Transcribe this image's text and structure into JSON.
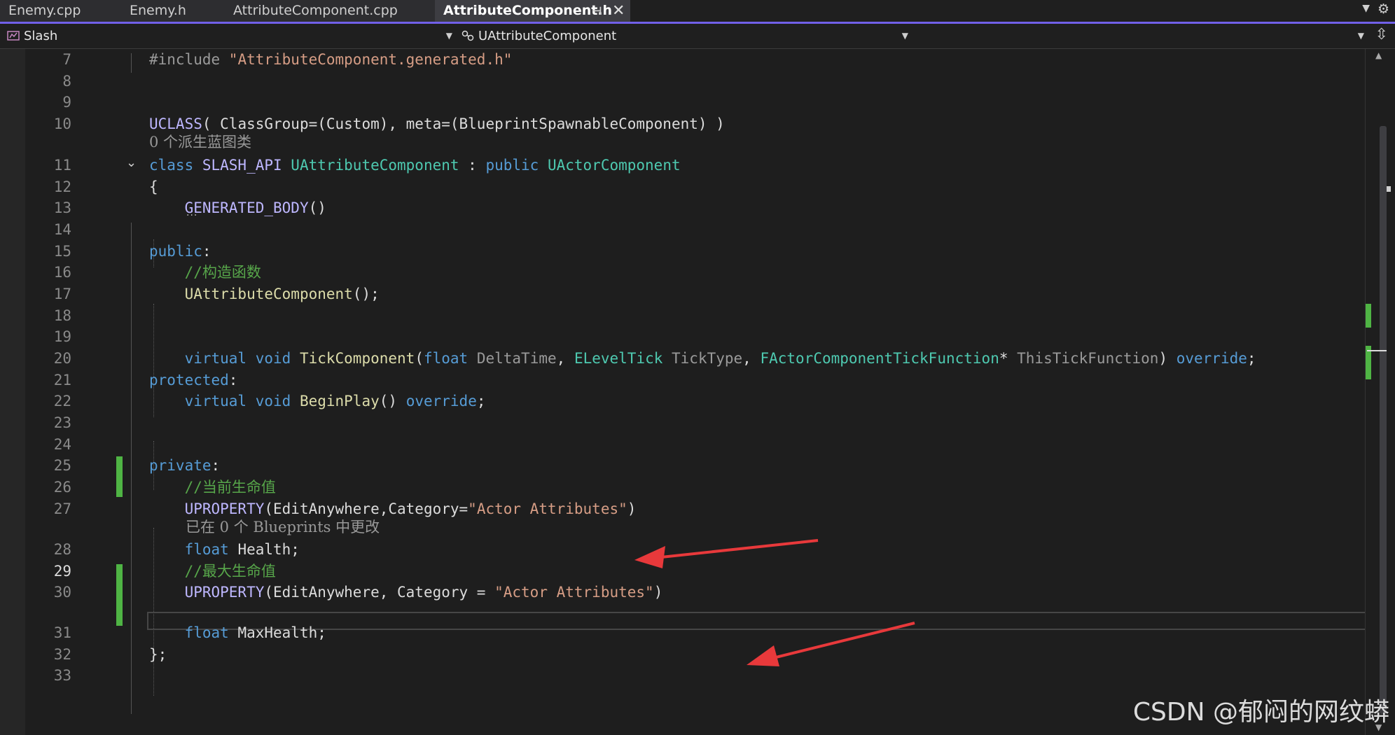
{
  "tabs": [
    {
      "label": "Enemy.cpp"
    },
    {
      "label": "Enemy.h"
    },
    {
      "label": "AttributeComponent.cpp"
    },
    {
      "label": "AttributeComponent.h"
    }
  ],
  "tab_pin_icon": "pin-icon",
  "tab_close_icon": "close-icon",
  "nav": {
    "project": "Slash",
    "scope": "UAttributeComponent",
    "member": ""
  },
  "editor": {
    "current_line": 29,
    "lines": [
      {
        "num": "7",
        "tokens": [
          [
            "p",
            "#include "
          ],
          [
            "s",
            "\"AttributeComponent.generated.h\""
          ]
        ]
      },
      {
        "num": "8",
        "tokens": []
      },
      {
        "num": "9",
        "tokens": []
      },
      {
        "num": "10",
        "tokens": [
          [
            "m",
            "UCLASS"
          ],
          [
            "w",
            "( "
          ],
          [
            "w",
            "ClassGroup=(Custom), meta=(BlueprintSpawnableComponent) )"
          ]
        ]
      },
      {
        "num": "11",
        "tokens": [
          [
            "k",
            "class "
          ],
          [
            "m",
            "SLASH_API "
          ],
          [
            "t",
            "UAttributeComponent"
          ],
          [
            "w",
            " : "
          ],
          [
            "k",
            "public "
          ],
          [
            "t",
            "UActorComponent"
          ]
        ]
      },
      {
        "num": "12",
        "tokens": [
          [
            "w",
            "{"
          ]
        ]
      },
      {
        "num": "13",
        "tokens": [
          [
            "w",
            "    "
          ],
          [
            "m",
            "GENERATED_BODY"
          ],
          [
            "w",
            "()"
          ]
        ]
      },
      {
        "num": "14",
        "tokens": []
      },
      {
        "num": "15",
        "tokens": [
          [
            "k",
            "public"
          ],
          [
            "w",
            ":"
          ]
        ]
      },
      {
        "num": "16",
        "tokens": [
          [
            "w",
            "    "
          ],
          [
            "c",
            "//构造函数"
          ]
        ]
      },
      {
        "num": "17",
        "tokens": [
          [
            "w",
            "    "
          ],
          [
            "f",
            "UAttributeComponent"
          ],
          [
            "w",
            "();"
          ]
        ]
      },
      {
        "num": "18",
        "tokens": []
      },
      {
        "num": "19",
        "tokens": []
      },
      {
        "num": "20",
        "tokens": [
          [
            "w",
            "    "
          ],
          [
            "k",
            "virtual "
          ],
          [
            "k",
            "void "
          ],
          [
            "f",
            "TickComponent"
          ],
          [
            "w",
            "("
          ],
          [
            "k",
            "float "
          ],
          [
            "p",
            "DeltaTime"
          ],
          [
            "w",
            ", "
          ],
          [
            "t",
            "ELevelTick "
          ],
          [
            "p",
            "TickType"
          ],
          [
            "w",
            ", "
          ],
          [
            "t",
            "FActorComponentTickFunction"
          ],
          [
            "w",
            "* "
          ],
          [
            "p",
            "ThisTickFunction"
          ],
          [
            "w",
            ") "
          ],
          [
            "k",
            "override"
          ],
          [
            "w",
            ";"
          ]
        ]
      },
      {
        "num": "21",
        "tokens": [
          [
            "k",
            "protected"
          ],
          [
            "w",
            ":"
          ]
        ]
      },
      {
        "num": "22",
        "tokens": [
          [
            "w",
            "    "
          ],
          [
            "k",
            "virtual "
          ],
          [
            "k",
            "void "
          ],
          [
            "f",
            "BeginPlay"
          ],
          [
            "w",
            "() "
          ],
          [
            "k",
            "override"
          ],
          [
            "w",
            ";"
          ]
        ]
      },
      {
        "num": "23",
        "tokens": []
      },
      {
        "num": "24",
        "tokens": []
      },
      {
        "num": "25",
        "tokens": [
          [
            "k",
            "private"
          ],
          [
            "w",
            ":"
          ]
        ]
      },
      {
        "num": "26",
        "tokens": [
          [
            "w",
            "    "
          ],
          [
            "c",
            "//当前生命值"
          ]
        ]
      },
      {
        "num": "27",
        "tokens": [
          [
            "w",
            "    "
          ],
          [
            "m",
            "UPROPERTY"
          ],
          [
            "w",
            "(EditAnywhere,Category="
          ],
          [
            "s",
            "\"Actor Attributes\""
          ],
          [
            "w",
            ")"
          ]
        ]
      },
      {
        "num": "28",
        "tokens": [
          [
            "w",
            "    "
          ],
          [
            "k",
            "float "
          ],
          [
            "w",
            "Health;"
          ]
        ]
      },
      {
        "num": "29",
        "tokens": [
          [
            "w",
            "    "
          ],
          [
            "c",
            "//最大生命值"
          ]
        ]
      },
      {
        "num": "30",
        "tokens": [
          [
            "w",
            "    "
          ],
          [
            "m",
            "UPROPERTY"
          ],
          [
            "w",
            "(EditAnywhere, Category = "
          ],
          [
            "s",
            "\"Actor Attributes\""
          ],
          [
            "w",
            ")"
          ]
        ]
      },
      {
        "num": "31",
        "tokens": [
          [
            "w",
            "    "
          ],
          [
            "k",
            "float "
          ],
          [
            "w",
            "MaxHealth;"
          ]
        ]
      },
      {
        "num": "32",
        "tokens": [
          [
            "w",
            "};"
          ]
        ]
      },
      {
        "num": "33",
        "tokens": []
      }
    ],
    "hints": {
      "derived_classes": "0 个派生蓝图类",
      "blueprints_changed": "已在 0 个 Blueprints 中更改"
    }
  },
  "colors": {
    "accent": "#7160e8",
    "keyword": "#569cd6",
    "type": "#4ec9b0",
    "function": "#dcdcaa",
    "string": "#d69d85",
    "macro": "#beb7ff",
    "comment": "#57a64a",
    "change_bar": "#4fb444",
    "annotation_arrow": "#e8393b"
  },
  "annotations": [
    "red-arrow",
    "red-arrow"
  ],
  "watermark": "CSDN @郁闷的网纹蟒"
}
